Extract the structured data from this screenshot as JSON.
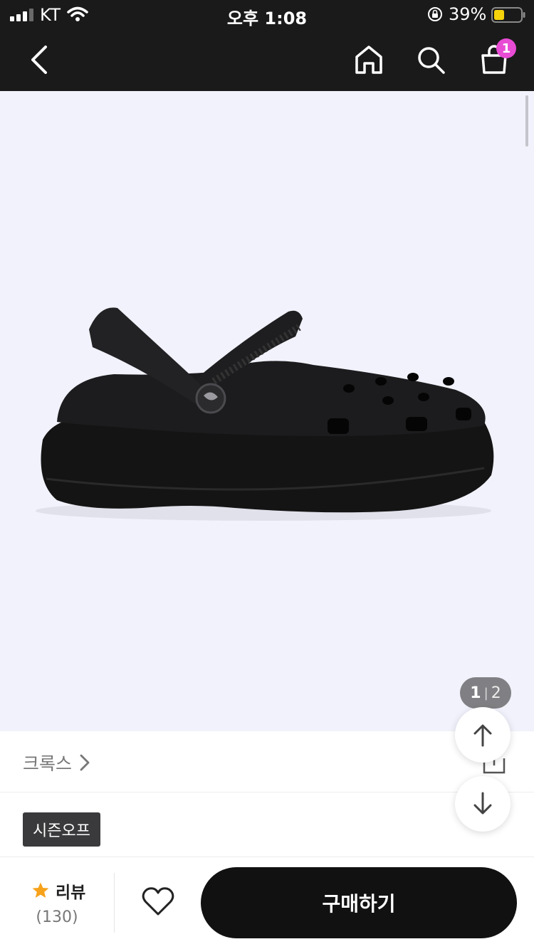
{
  "status_bar": {
    "carrier": "KT",
    "time": "오후 1:08",
    "battery_percent": "39%",
    "battery_level": 0.39,
    "battery_color": "#f5d20a"
  },
  "header": {
    "back_icon": "chevron-left-icon",
    "home_icon": "home-icon",
    "search_icon": "search-icon",
    "cart_icon": "shopping-bag-icon",
    "cart_badge": "1",
    "cart_badge_color": "#e84bd4"
  },
  "product": {
    "image_icon": "black-platform-clog",
    "page_current": "1",
    "page_separator": "|",
    "page_total": "2",
    "brand": "크록스",
    "badge": "시즌오프"
  },
  "bottom_bar": {
    "review_label": "리뷰",
    "review_count": "(130)",
    "star_color": "#f7a21b",
    "buy_label": "구매하기"
  }
}
